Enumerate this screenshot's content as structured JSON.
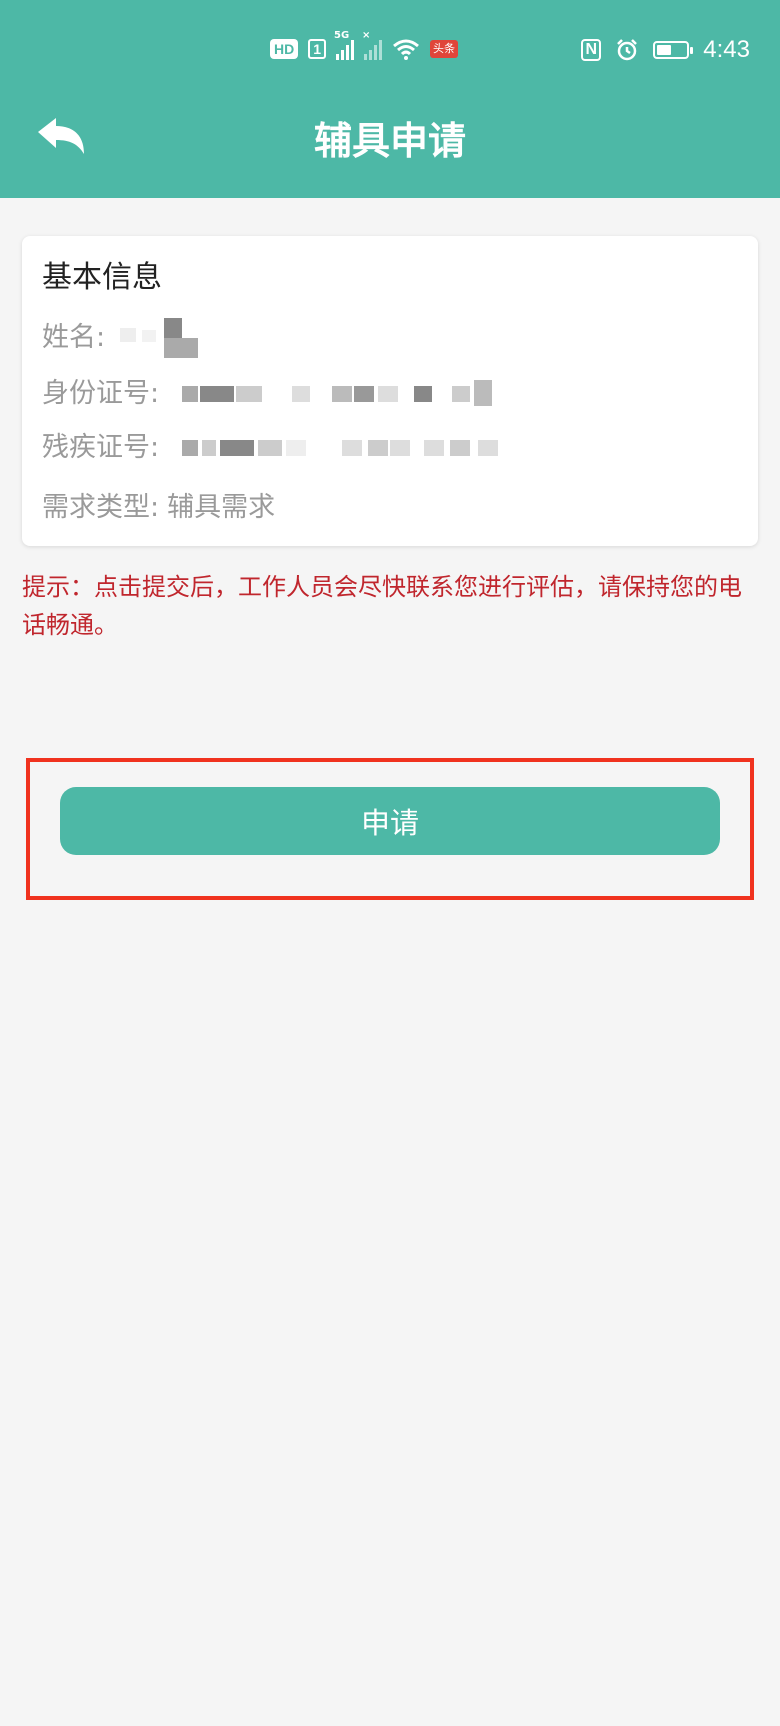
{
  "status_bar": {
    "hd_label": "HD",
    "sim_label": "1",
    "signal1_tag": "5G",
    "signal2_tag": "×",
    "news_label": "头条",
    "time": "4:43",
    "battery_level": 0.5,
    "icons": [
      "hd-icon",
      "sim-icon",
      "signal-icon",
      "wifi-icon",
      "news-icon",
      "nfc-icon",
      "alarm-icon",
      "battery-icon"
    ]
  },
  "header": {
    "title": "辅具申请",
    "back_icon": "back-arrow-icon",
    "color": "#4db8a6"
  },
  "card": {
    "title": "基本信息",
    "rows": [
      {
        "label": "姓名:",
        "value": ""
      },
      {
        "label": "身份证号:",
        "value": ""
      },
      {
        "label": "残疾证号:",
        "value": ""
      },
      {
        "label": "需求类型:",
        "value": "辅具需求"
      }
    ]
  },
  "tip": {
    "text": "提示：点击提交后，工作人员会尽快联系您进行评估，请保持您的电话畅通。",
    "color": "#c0262d"
  },
  "apply_button": {
    "label": "申请"
  },
  "colors": {
    "accent": "#4db8a6",
    "highlight": "#f0321e",
    "background": "#f5f5f5"
  }
}
